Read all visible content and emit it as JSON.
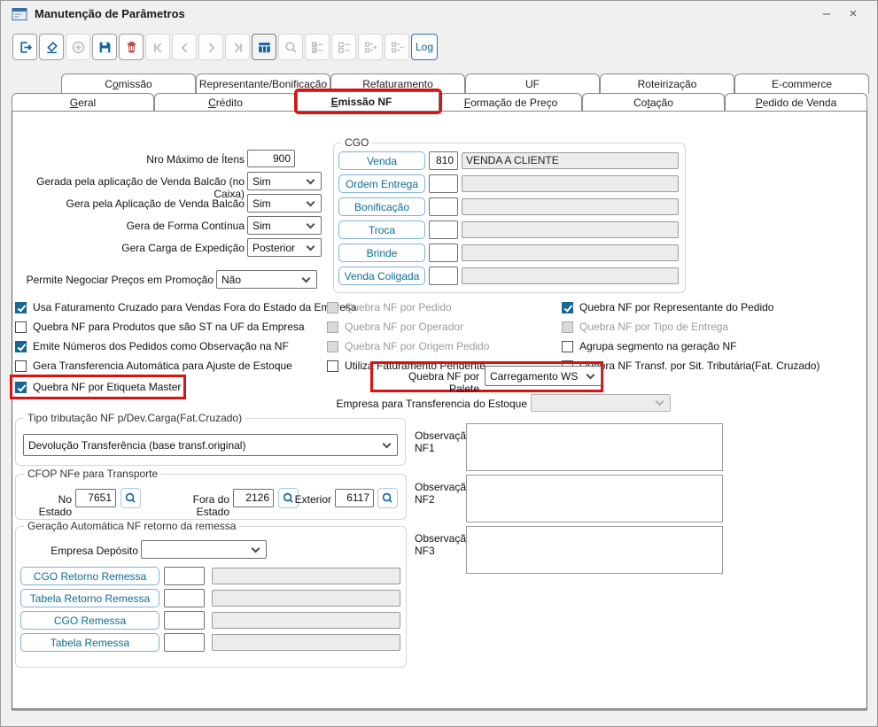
{
  "window": {
    "title": "Manutenção de Parâmetros",
    "minimize_glyph": "–",
    "close_glyph": "×"
  },
  "toolbar": {
    "log_label": "Log",
    "icons": [
      "exit-icon",
      "eraser-icon",
      "add-icon",
      "save-icon",
      "delete-icon",
      "first-record-icon",
      "previous-record-icon",
      "next-record-icon",
      "last-record-icon",
      "grid-icon",
      "search-icon",
      "checklist-icon",
      "list-icon",
      "list-add-icon",
      "list-remove-icon"
    ]
  },
  "tabs": {
    "row1": [
      {
        "label": "Comissão",
        "u": 1
      },
      {
        "label": "Representante/Bonificação",
        "u": -1
      },
      {
        "label": "Refaturamento",
        "u": -1
      },
      {
        "label": "UF",
        "u": -1
      },
      {
        "label": "Roteirização",
        "u": -1
      },
      {
        "label": "E-commerce",
        "u": -1
      }
    ],
    "row2": [
      {
        "label": "Geral",
        "u": 0
      },
      {
        "label": "Crédito",
        "u": 0
      },
      {
        "label": "Emissão NF",
        "u": 0,
        "selected": true,
        "highlight": true
      },
      {
        "label": "Formação de Preço",
        "u": 0
      },
      {
        "label": "Cotação",
        "u": 2
      },
      {
        "label": "Pedido de Venda",
        "u": 0
      }
    ]
  },
  "fields": {
    "nro_itens": {
      "label": "Nro Máximo de Ítens",
      "value": "900"
    },
    "venda_balcao_caixa": {
      "label": "Gerada pela aplicação de Venda Balcão (no Caixa)",
      "value": "Sim"
    },
    "venda_balcao": {
      "label": "Gera pela Aplicação de Venda Balcão",
      "value": "Sim"
    },
    "forma_continua": {
      "label": "Gera de Forma Contínua",
      "value": "Sim"
    },
    "carga_expedicao": {
      "label": "Gera Carga de Expedição",
      "value": "Posterior"
    },
    "negociar_promocao": {
      "label": "Permite Negociar Preços em Promoção",
      "value": "Não"
    },
    "palete": {
      "label": "Quebra NF por Palete",
      "value": "Carregamento WS"
    },
    "empresa_transferencia": {
      "label": "Empresa para Transferencia do Estoque",
      "value": ""
    },
    "empresa_deposito": {
      "label": "Empresa Depósito",
      "value": ""
    }
  },
  "cgo": {
    "title": "CGO",
    "rows": [
      {
        "button": "Venda",
        "code": "810",
        "desc": "VENDA A CLIENTE"
      },
      {
        "button": "Ordem Entrega",
        "code": "",
        "desc": ""
      },
      {
        "button": "Bonificação",
        "code": "",
        "desc": ""
      },
      {
        "button": "Troca",
        "code": "",
        "desc": ""
      },
      {
        "button": "Brinde",
        "code": "",
        "desc": ""
      },
      {
        "button": "Venda Coligada",
        "code": "",
        "desc": ""
      }
    ]
  },
  "checks": {
    "col1": [
      {
        "label": "Usa Faturamento Cruzado para Vendas Fora do Estado da Empresa",
        "checked": true
      },
      {
        "label": "Quebra NF para Produtos que são ST na UF da Empresa",
        "checked": false
      },
      {
        "label": "Emite Números dos Pedidos como Observação na NF",
        "checked": true
      },
      {
        "label": "Gera Transferencia Automática para Ajuste de Estoque",
        "checked": false
      },
      {
        "label": "Quebra NF por Etiqueta Master",
        "checked": true,
        "highlight": true
      }
    ],
    "col2": [
      {
        "label": "Quebra NF por Pedido",
        "checked": false,
        "disabled": true
      },
      {
        "label": "Quebra NF por Operador",
        "checked": false,
        "disabled": true
      },
      {
        "label": "Quebra NF por Origem Pedido",
        "checked": false,
        "disabled": true
      },
      {
        "label": "Utiliza Faturamento Pendente",
        "checked": false
      }
    ],
    "col3": [
      {
        "label": "Quebra NF por Representante do Pedido",
        "checked": true
      },
      {
        "label": "Quebra NF por Tipo de Entrega",
        "checked": false,
        "disabled": true
      },
      {
        "label": "Agrupa segmento na geração NF",
        "checked": false
      },
      {
        "label": "Quebra NF Transf. por Sit. Tributária(Fat. Cruzado)",
        "checked": false
      }
    ]
  },
  "tributacao": {
    "title": "Tipo tributação NF p/Dev.Carga(Fat.Cruzado)",
    "value": "Devolução Transferência (base transf.original)"
  },
  "cfop": {
    "title": "CFOP NFe para Transporte",
    "no_estado": {
      "label": "No Estado",
      "value": "7651"
    },
    "fora_estado": {
      "label": "Fora do Estado",
      "value": "2126"
    },
    "exterior": {
      "label": "Exterior",
      "value": "6117"
    }
  },
  "remessa": {
    "title": "Geração Automática NF retorno da remessa",
    "rows": [
      {
        "button": "CGO Retorno Remessa",
        "code": "",
        "desc": ""
      },
      {
        "button": "Tabela Retorno Remessa",
        "code": "",
        "desc": ""
      },
      {
        "button": "CGO Remessa",
        "code": "",
        "desc": ""
      },
      {
        "button": "Tabela Remessa",
        "code": "",
        "desc": ""
      }
    ]
  },
  "observacoes": [
    {
      "line1": "Observação",
      "line2": "NF1",
      "value": ""
    },
    {
      "line1": "Observação",
      "line2": "NF2",
      "value": ""
    },
    {
      "line1": "Observação",
      "line2": "NF3",
      "value": ""
    }
  ],
  "colors": {
    "accent_blue": "#11639c",
    "danger_red": "#bf3c3b",
    "highlight_red": "#dd1111",
    "check_blue": "#16688f",
    "cgo_button_border": "#7fb2da",
    "cgo_button_text": "#0d6d95"
  }
}
